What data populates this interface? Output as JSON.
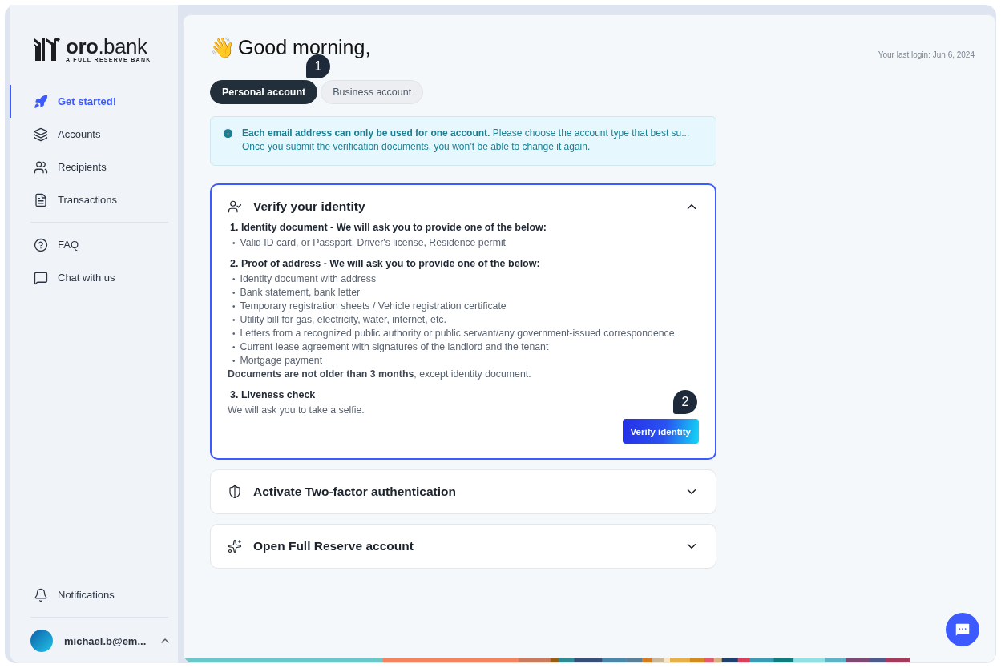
{
  "sidebar": {
    "logo": {
      "name": "oro",
      "suffix": ".bank",
      "tagline": "A FULL RESERVE BANK"
    },
    "nav_items": [
      {
        "label": "Get started!",
        "selected": true
      },
      {
        "label": "Accounts",
        "selected": false
      },
      {
        "label": "Recipients",
        "selected": false
      },
      {
        "label": "Transactions",
        "selected": false
      }
    ],
    "help_items": [
      {
        "label": "FAQ",
        "selected": false
      },
      {
        "label": "Chat with us",
        "selected": false
      }
    ],
    "notifications": {
      "label": "Notifications"
    },
    "user": {
      "email": "michael.b@em..."
    }
  },
  "greeting": {
    "emoji": "👋",
    "text": "Good morning,"
  },
  "last_login": "Your last login: Jun 6, 2024",
  "account_tabs": [
    {
      "label": "Personal account",
      "selected": true
    },
    {
      "label": "Business account",
      "selected": false
    }
  ],
  "tab_badge": "1",
  "notice": {
    "line_1": "**Each email address can only be used for one account.** Please choose the account type that best su...",
    "line_2": "Once you submit the verification documents, you won’t be able to change it again."
  },
  "steps": [
    {
      "kind": "identity",
      "title": "Verify your identity",
      "expanded": true,
      "bullet": "•",
      "sections": [
        {
          "heading": "1. Identity document - We will ask you to provide one of the below:",
          "items": [
            "Valid ID card, or Passport, Driver's license, Residence permit"
          ]
        },
        {
          "heading": "2. Proof of address - We will ask you to provide one of the below:",
          "items": [
            "Identity document with address",
            "Bank statement, bank letter",
            "Temporary registration sheets / Vehicle registration certificate",
            "Utility bill for gas, electricity, water, internet, etc.",
            "Letters from a recognized public authority or public servant/any government-issued correspondence",
            "Current lease agreement with signatures of the landlord and the tenant",
            "Mortgage payment"
          ],
          "note": "**Documents are not older than 3 months**, except identity document."
        },
        {
          "heading": "3. Liveness check",
          "note": "We will ask you to take a selfie."
        }
      ],
      "button": "Verify identity",
      "badge": "2"
    },
    {
      "kind": "security",
      "title": "Activate Two-factor authentication",
      "expanded": false
    },
    {
      "kind": "account",
      "title": "Open Full Reserve account",
      "expanded": false
    }
  ]
}
